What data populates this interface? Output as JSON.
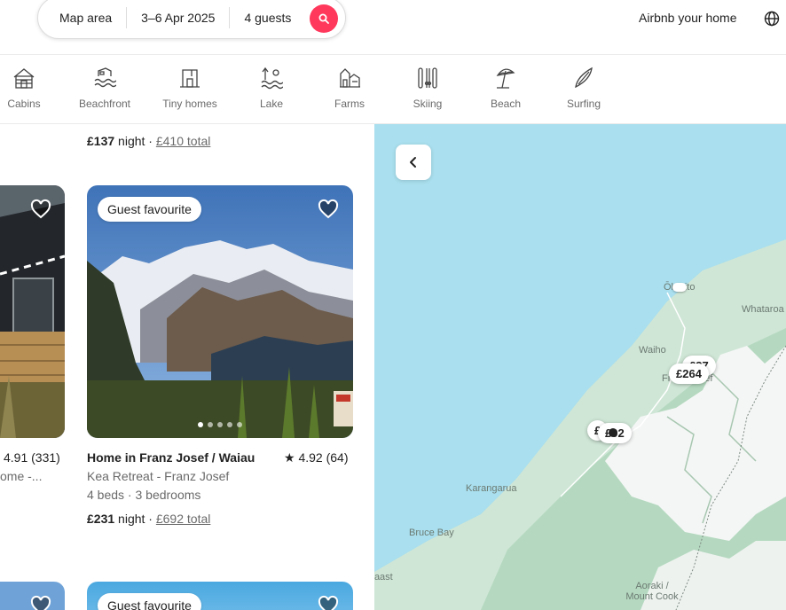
{
  "search": {
    "location": "Map area",
    "dates": "3–6 Apr 2025",
    "guests": "4 guests"
  },
  "header": {
    "host_link": "Airbnb your home"
  },
  "categories": [
    {
      "label": "Cabins",
      "icon": "cabin-icon"
    },
    {
      "label": "Beachfront",
      "icon": "beachfront-icon"
    },
    {
      "label": "Tiny homes",
      "icon": "tiny-home-icon"
    },
    {
      "label": "Lake",
      "icon": "lake-icon"
    },
    {
      "label": "Farms",
      "icon": "farm-icon"
    },
    {
      "label": "Skiing",
      "icon": "skiing-icon"
    },
    {
      "label": "Beach",
      "icon": "beach-umbrella-icon"
    },
    {
      "label": "Surfing",
      "icon": "surfboard-icon"
    }
  ],
  "listings": {
    "prev_row_price": {
      "amount": "£137",
      "unit": "night",
      "sep": "·",
      "total": "£410 total"
    },
    "left_card": {
      "rating": "4.91 (331)",
      "subtitle": "ome -..."
    },
    "main_card": {
      "badge": "Guest favourite",
      "title": "Home in Franz Josef / Waiau",
      "rating": "★ 4.92 (64)",
      "host": "Kea Retreat - Franz Josef",
      "details": "4 beds · 3 bedrooms",
      "price": {
        "amount": "£231",
        "unit": "night",
        "sep": "·",
        "total": "£692 total"
      },
      "photo_count": 5,
      "active_photo": 0
    },
    "next_card": {
      "badge": "Guest favourite"
    }
  },
  "map": {
    "places": [
      "Ōkārito",
      "Whataroa",
      "Waiho",
      "Franz Josef",
      "Karangarua",
      "Bruce Bay",
      "Haast",
      "Aoraki / Mount Cook"
    ],
    "pins": [
      "£264",
      "£37",
      "£",
      "£92"
    ],
    "colors": {
      "water": "#a9dfee",
      "land": "#cfe6d6",
      "forest": "#b5d9c0",
      "snow": "#f4f6f5",
      "accent": "#ff385c"
    }
  }
}
